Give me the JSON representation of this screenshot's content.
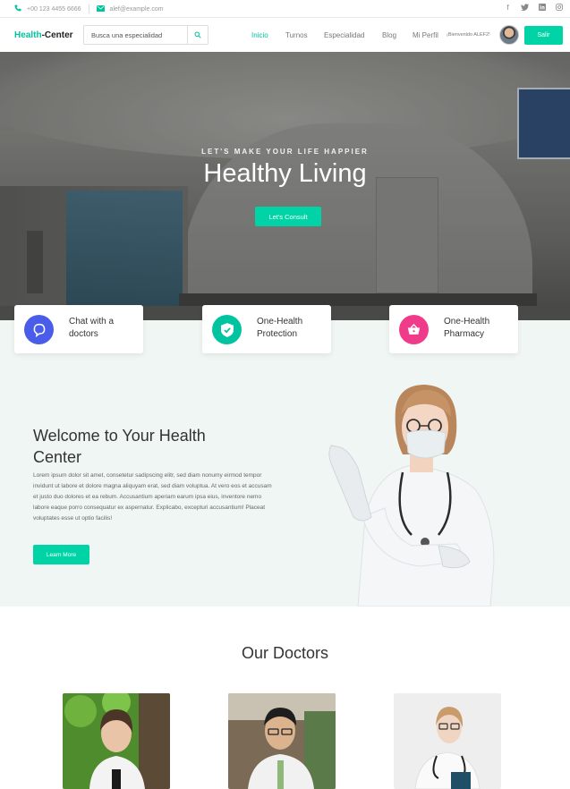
{
  "topbar": {
    "phone": "+00 123 4455 6666",
    "email": "alef@example.com",
    "social_icons": [
      "facebook-icon",
      "twitter-icon",
      "linkedin-icon",
      "instagram-icon"
    ]
  },
  "navbar": {
    "brand_part1": "Health",
    "brand_part2": "-Center",
    "search_placeholder": "Busca una especialidad",
    "links": [
      "Inicio",
      "Turnos",
      "Especialidad",
      "Blog",
      "Mi Perfil"
    ],
    "active_link": "Inicio",
    "welcome_text": "¡Bienvenido ALEF2!",
    "logout_label": "Salir"
  },
  "hero": {
    "kicker": "LET'S MAKE YOUR LIFE HAPPIER",
    "title": "Healthy Living",
    "cta_label": "Let's Consult"
  },
  "features": [
    {
      "label": "Chat with a doctors",
      "icon": "chat-icon",
      "color": "#4a5de8"
    },
    {
      "label": "One-Health Protection",
      "icon": "shield-check-icon",
      "color": "#00c49f"
    },
    {
      "label": "One-Health Pharmacy",
      "icon": "basket-icon",
      "color": "#f03b8a"
    }
  ],
  "welcome": {
    "title": "Welcome to Your Health Center",
    "body": "Lorem ipsum dolor sit amet, consetetur sadipscing elitr, sed diam nonumy eirmod tempor invidunt ut labore et dolore magna aliquyam erat, sed diam voluptua. At vero eos et accusam et justo duo dolores et ea rebum. Accusantium aperiam earum ipsa eius, inventore nemo labore eaque porro consequatur ex aspernatur. Explicabo, excepturi accusantium! Placeat voluptates esse ut optio facilis!",
    "cta_label": "Learn More"
  },
  "doctors_section": {
    "title": "Our Doctors"
  },
  "colors": {
    "accent": "#00d4a7",
    "brand_green": "#00c49f",
    "section_bg": "#f0f6f3"
  }
}
